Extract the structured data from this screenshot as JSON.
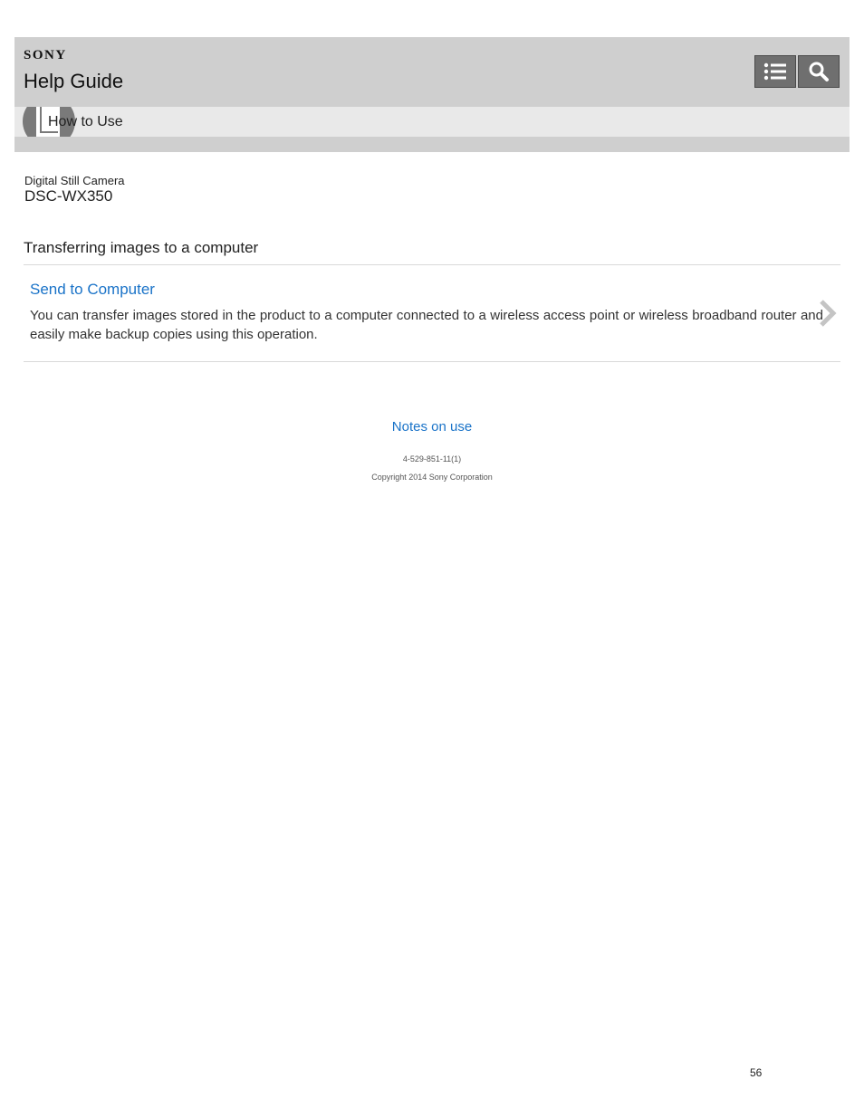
{
  "header": {
    "brand": "SONY",
    "title": "Help Guide",
    "menu_icon": "list-icon",
    "search_icon": "search-icon"
  },
  "subbar": {
    "icon": "book-icon",
    "label": "How to Use"
  },
  "product": {
    "type": "Digital Still Camera",
    "model": "DSC-WX350"
  },
  "section": {
    "title": "Transferring images to a computer"
  },
  "topic": {
    "title": "Send to Computer",
    "description": "You can transfer images stored in the product to a computer connected to a wireless access point or wireless broadband router and easily make backup copies using this operation.",
    "chevron_icon": "chevron-right-icon"
  },
  "footer": {
    "notes_link": "Notes on use",
    "doc_number": "4-529-851-11(1)",
    "copyright": "Copyright 2014 Sony Corporation"
  },
  "page_number": "56",
  "colors": {
    "header_bg": "#cfcfcf",
    "subbar_bg": "#e9e9e9",
    "link": "#1a73c8",
    "button_bg": "#6f6f6f"
  }
}
